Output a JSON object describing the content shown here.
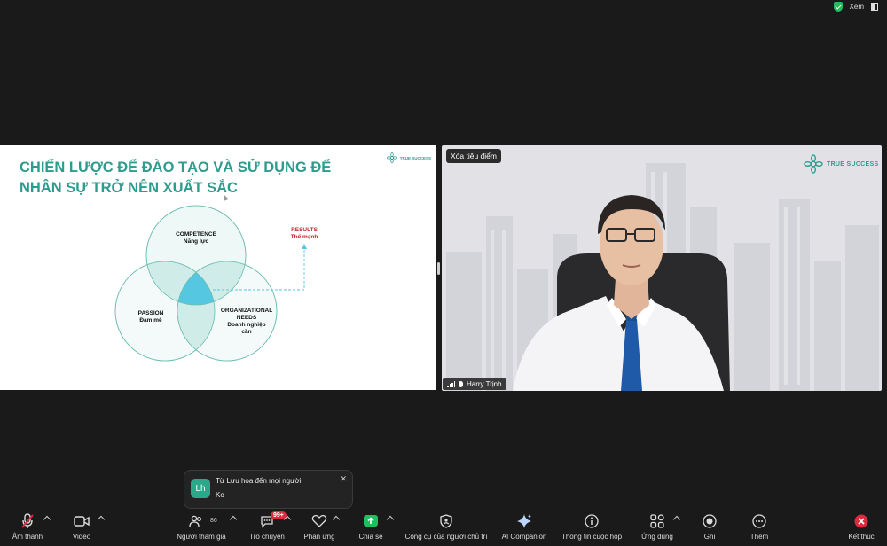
{
  "topbar": {
    "view_label": "Xem"
  },
  "slide": {
    "title": "CHIẾN LƯỢC ĐỂ ĐÀO TẠO VÀ SỬ DỤNG ĐỂ NHÂN SỰ TRỞ NÊN XUẤT SẮC",
    "logo_text": "TRUE SUCCESS",
    "competence": "COMPETENCE",
    "competence_vi": "Năng lực",
    "passion": "PASSION",
    "passion_vi": "Đam mê",
    "org_needs": "ORGANIZATIONAL NEEDS",
    "org_needs_vi": "Doanh nghiệp cần",
    "results": "RESULTS",
    "results_vi": "Thế mạnh",
    "colors": {
      "teal": "#2d9c8f",
      "red": "#c0262c",
      "center": "#56c7e0"
    }
  },
  "video": {
    "spotlight_button": "Xóa tiêu điểm",
    "logo_text": "TRUE SUCCESS",
    "participant_name": "Harry Trịnh"
  },
  "toast": {
    "avatar": "Lh",
    "title": "Từ Lưu hoa đến mọi người",
    "message": "Ko"
  },
  "toolbar": {
    "audio": "Âm thanh",
    "video": "Video",
    "participants": "Người tham gia",
    "participants_count": "86",
    "chat": "Trò chuyện",
    "chat_badge": "99+",
    "reactions": "Phản ứng",
    "share": "Chia sẻ",
    "host_tools": "Công cụ của người chủ trì",
    "ai_companion": "AI Companion",
    "meeting_info": "Thông tin cuộc họp",
    "apps": "Ứng dụng",
    "record": "Ghi",
    "more": "Thêm",
    "end": "Kết thúc",
    "share_color": "#1fbf5f",
    "end_color": "#e0293f"
  }
}
